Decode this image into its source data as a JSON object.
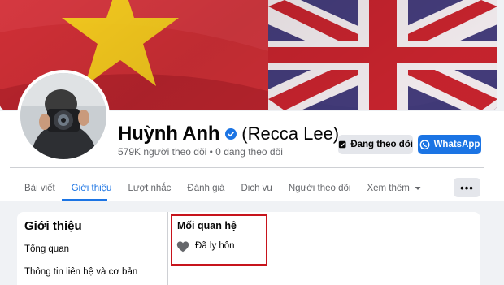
{
  "profile": {
    "name": "Huỳnh Anh",
    "alias": "(Recca Lee)",
    "follow_stats": "579K người theo dõi • 0 đang theo dõi"
  },
  "actions": {
    "following_label": "Đang theo dõi",
    "whatsapp_label": "WhatsApp"
  },
  "tabs": [
    {
      "label": "Bài viết"
    },
    {
      "label": "Giới thiệu",
      "active": true
    },
    {
      "label": "Lượt nhắc"
    },
    {
      "label": "Đánh giá"
    },
    {
      "label": "Dịch vụ"
    },
    {
      "label": "Người theo dõi"
    },
    {
      "label": "Xem thêm"
    }
  ],
  "more_button": "•••",
  "about": {
    "title": "Giới thiệu",
    "sidebar": [
      "Tổng quan",
      "Thông tin liên hệ và cơ bản"
    ],
    "section_title": "Mối quan hệ",
    "relationship_status": "Đã ly hôn"
  },
  "colors": {
    "accent": "#1b74e4",
    "highlight": "#c7141c"
  }
}
